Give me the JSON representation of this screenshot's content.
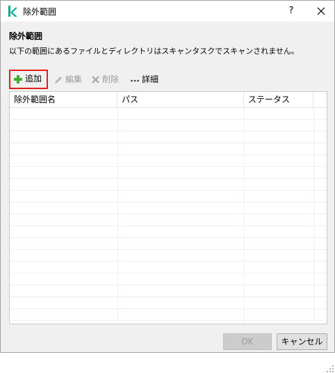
{
  "window": {
    "title": "除外範囲",
    "help_label": "?",
    "brand_color": "#00a88e"
  },
  "main": {
    "heading": "除外範囲",
    "description": "以下の範囲にあるファイルとディレクトリはスキャンタスクでスキャンされません。"
  },
  "toolbar": {
    "add": {
      "label": "追加",
      "icon": "plus-icon",
      "enabled": true
    },
    "edit": {
      "label": "編集",
      "icon": "pencil-icon",
      "enabled": false
    },
    "delete": {
      "label": "削除",
      "icon": "x-icon",
      "enabled": false
    },
    "details": {
      "label": "詳細",
      "icon": "more-icon",
      "enabled": true
    }
  },
  "table": {
    "columns": [
      "除外範囲名",
      "パス",
      "ステータス"
    ],
    "rows": []
  },
  "footer": {
    "ok_label": "OK",
    "cancel_label": "キャンセル"
  }
}
